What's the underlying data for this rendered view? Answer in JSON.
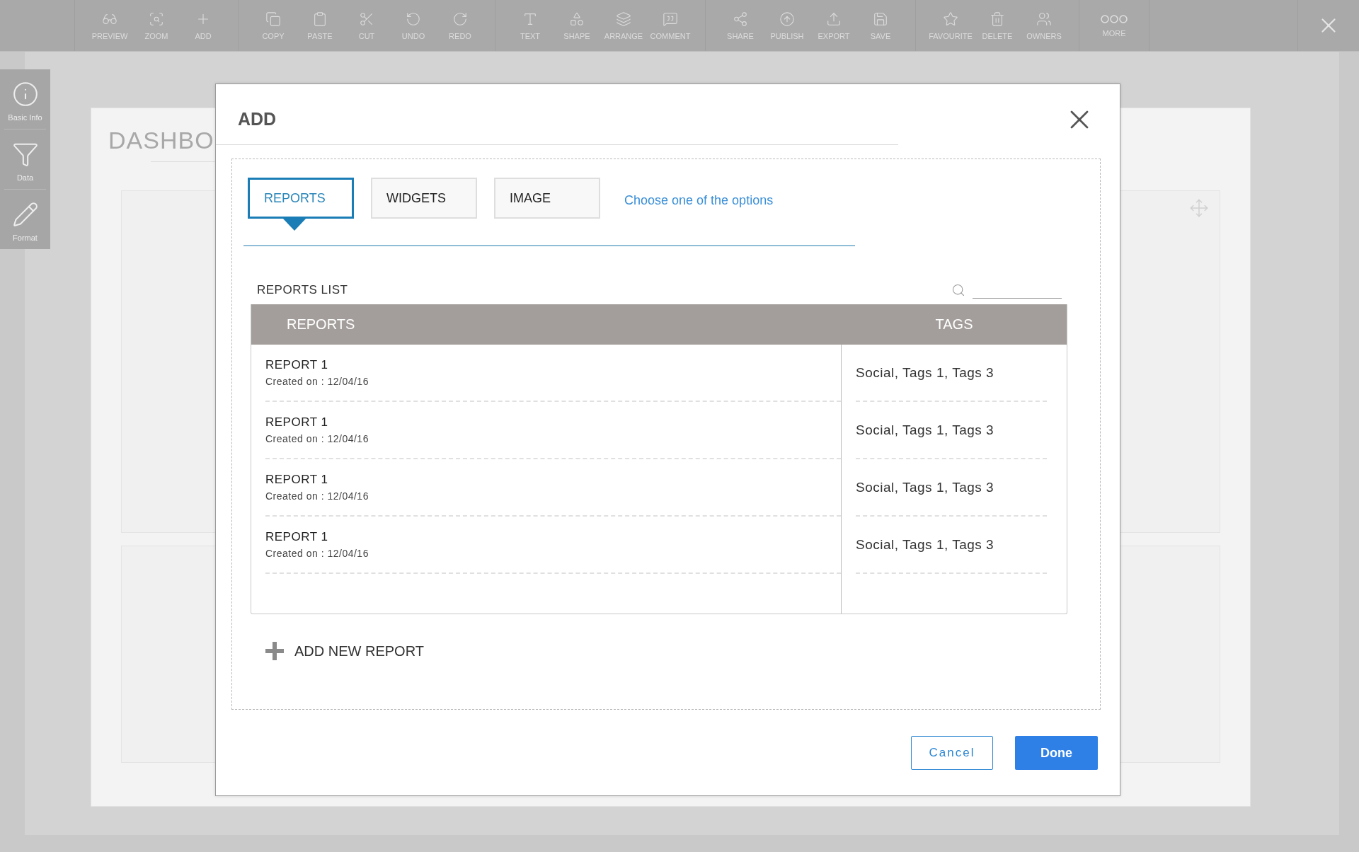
{
  "toolbar": {
    "groups": [
      [
        {
          "label": "PREVIEW"
        },
        {
          "label": "ZOOM"
        },
        {
          "label": "ADD"
        }
      ],
      [
        {
          "label": "COPY"
        },
        {
          "label": "PASTE"
        },
        {
          "label": "CUT"
        },
        {
          "label": "UNDO"
        },
        {
          "label": "REDO"
        }
      ],
      [
        {
          "label": "TEXT"
        },
        {
          "label": "SHAPE"
        },
        {
          "label": "ARRANGE"
        },
        {
          "label": "COMMENT"
        }
      ],
      [
        {
          "label": "SHARE"
        },
        {
          "label": "PUBLISH"
        },
        {
          "label": "EXPORT"
        },
        {
          "label": "SAVE"
        }
      ],
      [
        {
          "label": "FAVOURITE"
        },
        {
          "label": "DELETE"
        },
        {
          "label": "OWNERS"
        }
      ],
      [
        {
          "label": "MORE"
        }
      ]
    ]
  },
  "sidebar": {
    "items": [
      {
        "label": "Basic Info"
      },
      {
        "label": "Data"
      },
      {
        "label": "Format"
      }
    ]
  },
  "dashboard": {
    "title": "DASHBO"
  },
  "dialog": {
    "title": "ADD",
    "tabs": [
      {
        "label": "REPORTS",
        "selected": true
      },
      {
        "label": "WIDGETS",
        "selected": false
      },
      {
        "label": "IMAGE",
        "selected": false
      }
    ],
    "hint": "Choose one of the options",
    "list_title": "REPORTS  LIST",
    "table": {
      "columns": [
        "REPORTS",
        "TAGS"
      ],
      "rows": [
        {
          "name": "REPORT  1",
          "created": "Created  on : 12/04/16",
          "tags": "Social,  Tags  1,  Tags  3"
        },
        {
          "name": "REPORT  1",
          "created": "Created  on : 12/04/16",
          "tags": "Social,  Tags  1,  Tags  3"
        },
        {
          "name": "REPORT  1",
          "created": "Created  on : 12/04/16",
          "tags": "Social,  Tags  1,  Tags  3"
        },
        {
          "name": "REPORT  1",
          "created": "Created  on : 12/04/16",
          "tags": "Social,  Tags  1,  Tags  3"
        }
      ]
    },
    "add_new": "ADD NEW REPORT",
    "buttons": {
      "cancel": "Cancel",
      "done": "Done"
    }
  }
}
